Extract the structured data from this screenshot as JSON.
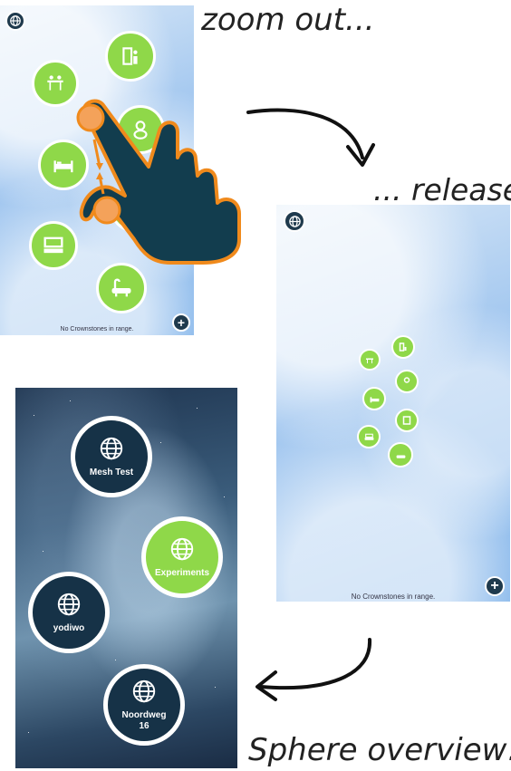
{
  "captions": {
    "zoom_out": "zoom out...",
    "release": "... release",
    "sphere_overview": "Sphere overview!"
  },
  "screen1": {
    "status": "No Crownstones in range."
  },
  "screen2": {
    "status": "No Crownstones in range."
  },
  "screen3": {
    "spheres": [
      {
        "label": "Mesh Test",
        "active": false
      },
      {
        "label": "Experiments",
        "active": true
      },
      {
        "label": "yodiwo",
        "active": false
      },
      {
        "label": "Noordweg 16",
        "active": false
      }
    ]
  },
  "colors": {
    "room_green": "#8fd849",
    "dark_navy": "#163247",
    "arrow_orange": "#f08a1c",
    "hand_fill": "#123d4e"
  },
  "icons": {
    "rooms": [
      "dining-table-icon",
      "bookcase-icon",
      "baby-icon",
      "bed-icon",
      "tv-stand-icon",
      "bathtub-icon",
      "washing-machine-icon"
    ]
  }
}
